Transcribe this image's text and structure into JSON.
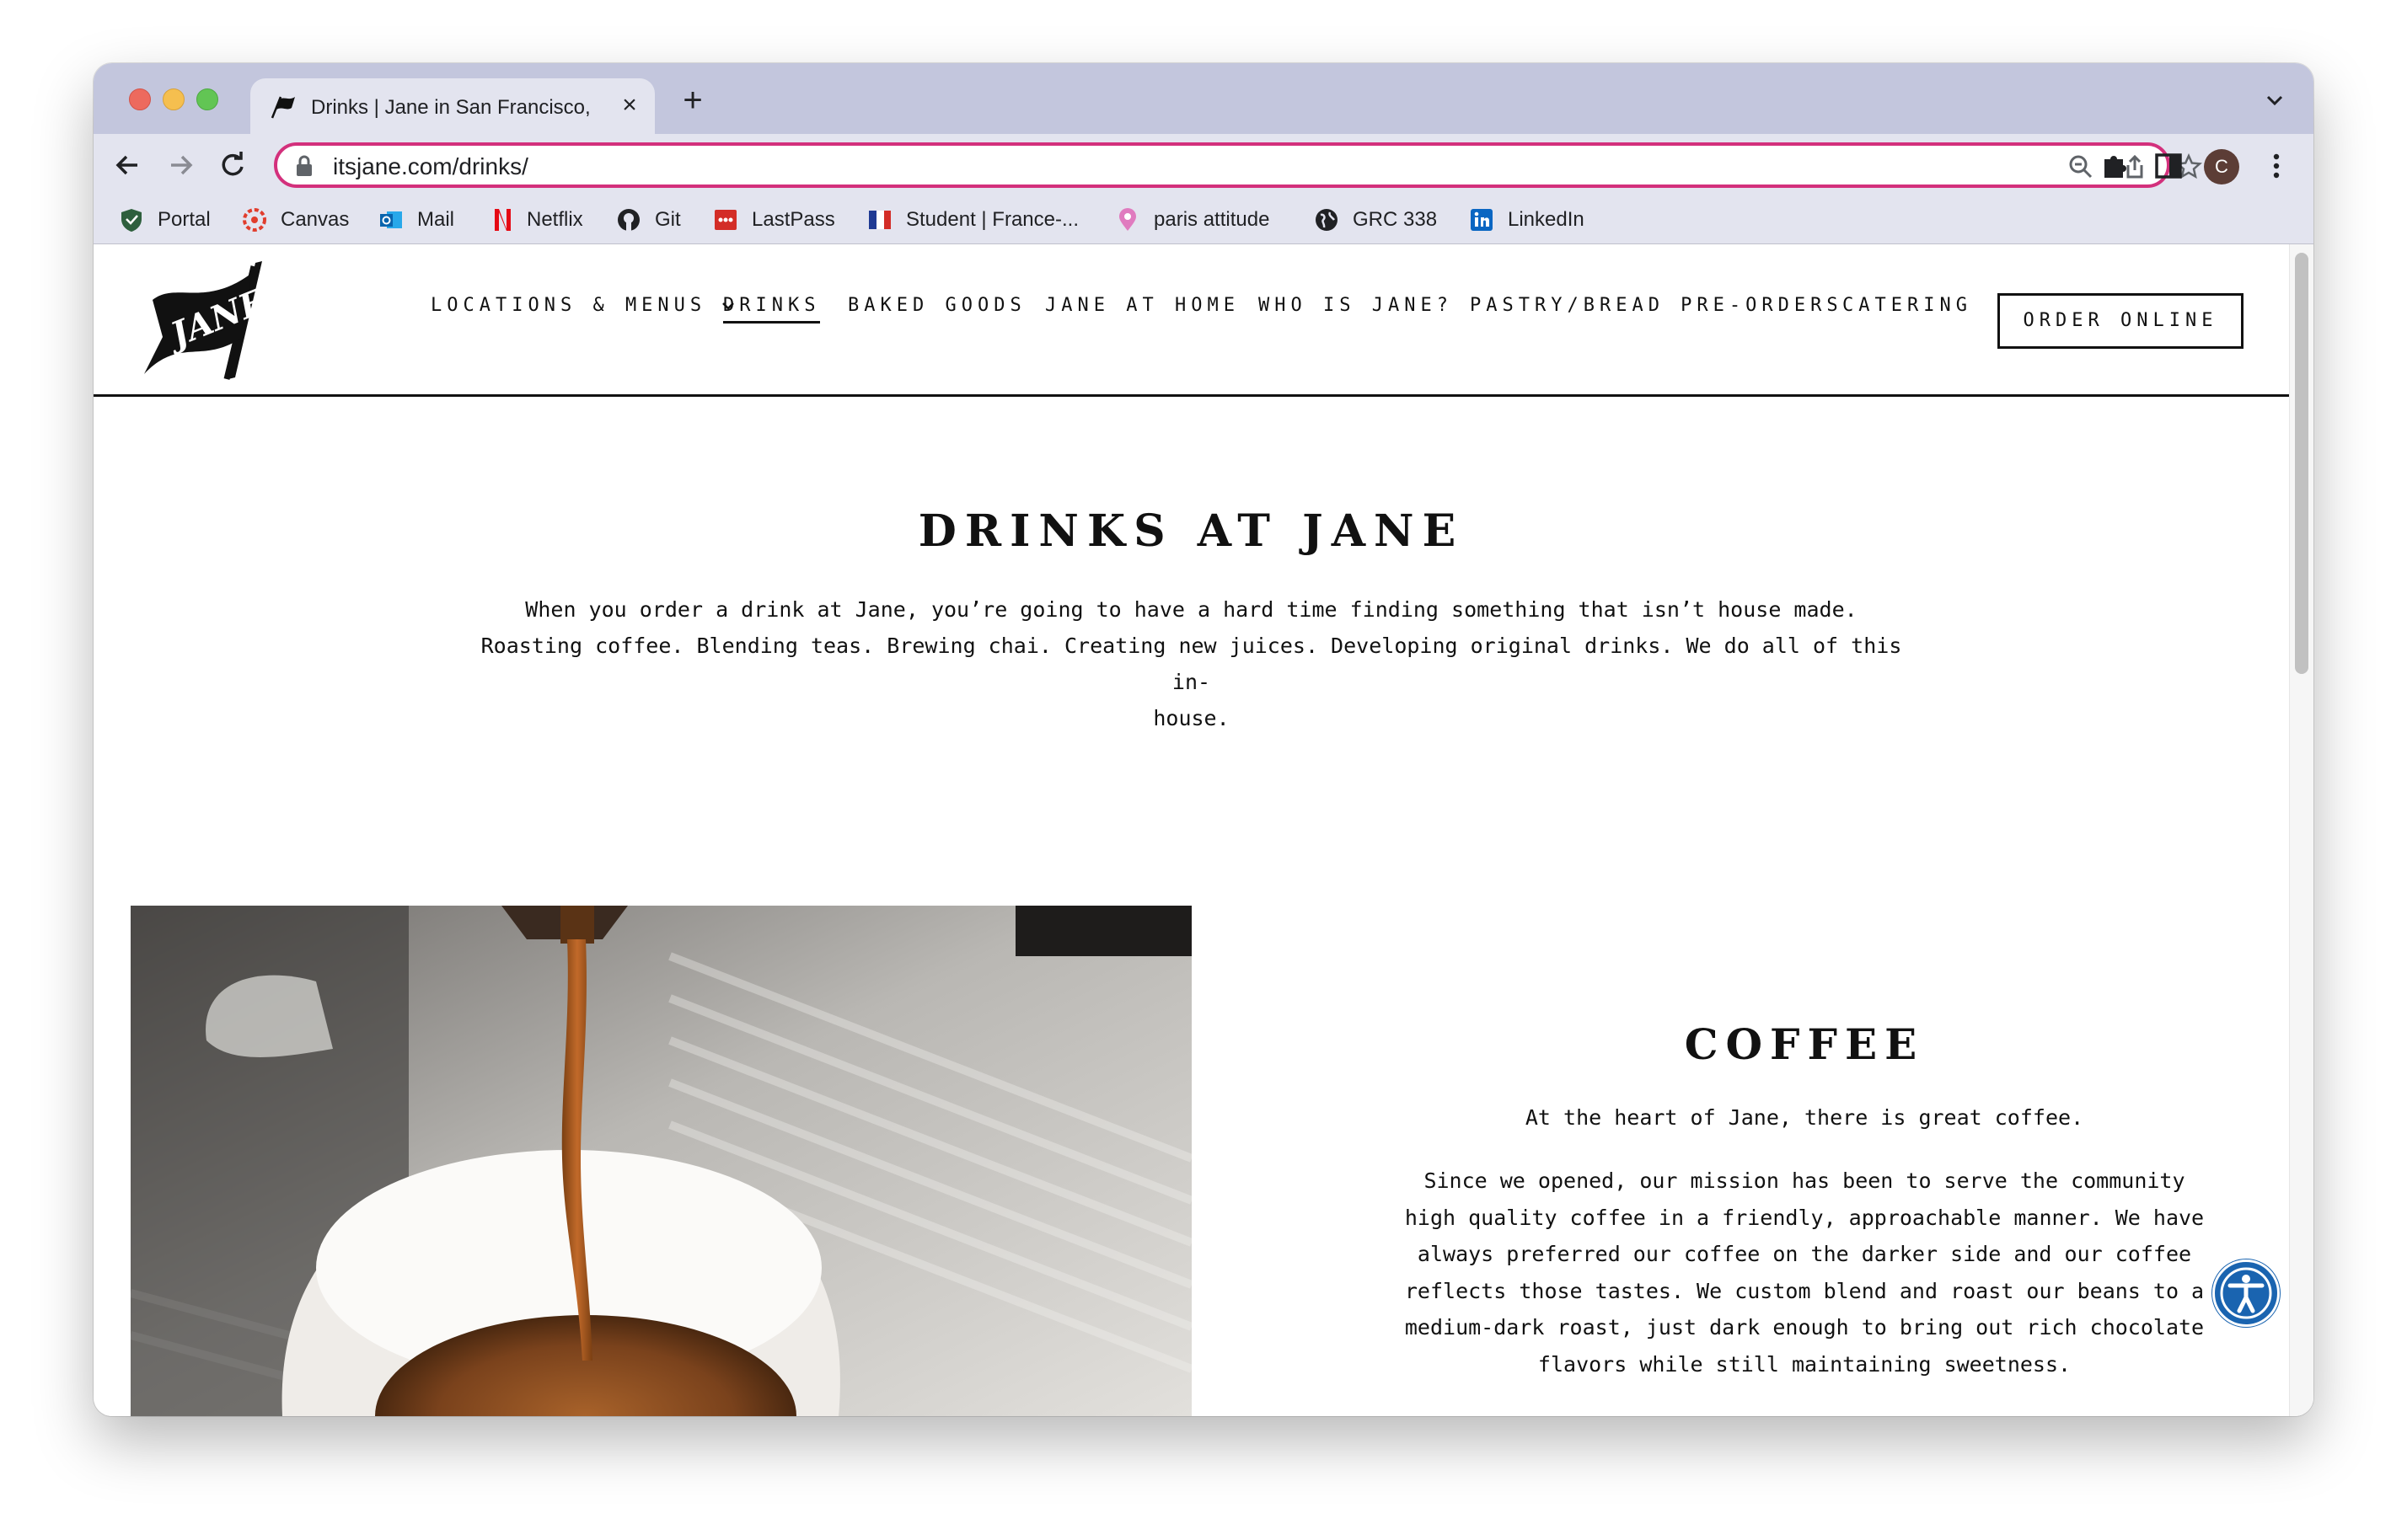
{
  "browser": {
    "tab": {
      "title": "Drinks | Jane in San Francisco,",
      "favicon": "jane-flag-icon"
    },
    "url": "itsjane.com/drinks/",
    "profile_initial": "C",
    "bookmarks": [
      {
        "label": "Portal",
        "icon": "shield-icon"
      },
      {
        "label": "Canvas",
        "icon": "canvas-icon"
      },
      {
        "label": "Mail",
        "icon": "outlook-icon"
      },
      {
        "label": "Netflix",
        "icon": "netflix-icon"
      },
      {
        "label": "Git",
        "icon": "github-icon"
      },
      {
        "label": "LastPass",
        "icon": "lastpass-icon"
      },
      {
        "label": "Student | France-...",
        "icon": "france-flag-icon"
      },
      {
        "label": "paris attitude",
        "icon": "location-pin-icon"
      },
      {
        "label": "GRC 338",
        "icon": "globe-icon"
      },
      {
        "label": "LinkedIn",
        "icon": "linkedin-icon"
      }
    ]
  },
  "site": {
    "nav": [
      "LOCATIONS & MENUS",
      "DRINKS",
      "BAKED GOODS",
      "JANE AT HOME",
      "WHO IS JANE?",
      "PASTRY/BREAD PRE-ORDERS",
      "CATERING"
    ],
    "active_nav": "DRINKS",
    "order_button": "ORDER ONLINE",
    "logo_text": "JANE"
  },
  "content": {
    "title": "DRINKS AT JANE",
    "intro_lines": [
      "When you order a drink at Jane, you’re going to have a hard time finding something that isn’t house made.",
      "Roasting coffee. Blending teas. Brewing chai. Creating new juices. Developing original drinks. We do all of this in-",
      "house."
    ],
    "section": {
      "title": "COFFEE",
      "lede": "At the heart of Jane, there is great coffee.",
      "body_lines": [
        "Since we opened, our mission has been to serve the community",
        "high quality coffee in a friendly, approachable manner. We have",
        "always preferred our coffee on the darker side and our coffee",
        "reflects those tastes. We custom blend and roast our beans to a",
        "medium-dark roast, just dark enough to bring out rich chocolate",
        "flavors while still maintaining sweetness."
      ]
    }
  },
  "colors": {
    "omnibox_focus": "#d3307c",
    "tabstrip": "#c3c6dd",
    "toolbar": "#e3e4ef",
    "a11y_button": "#1a64b0"
  }
}
